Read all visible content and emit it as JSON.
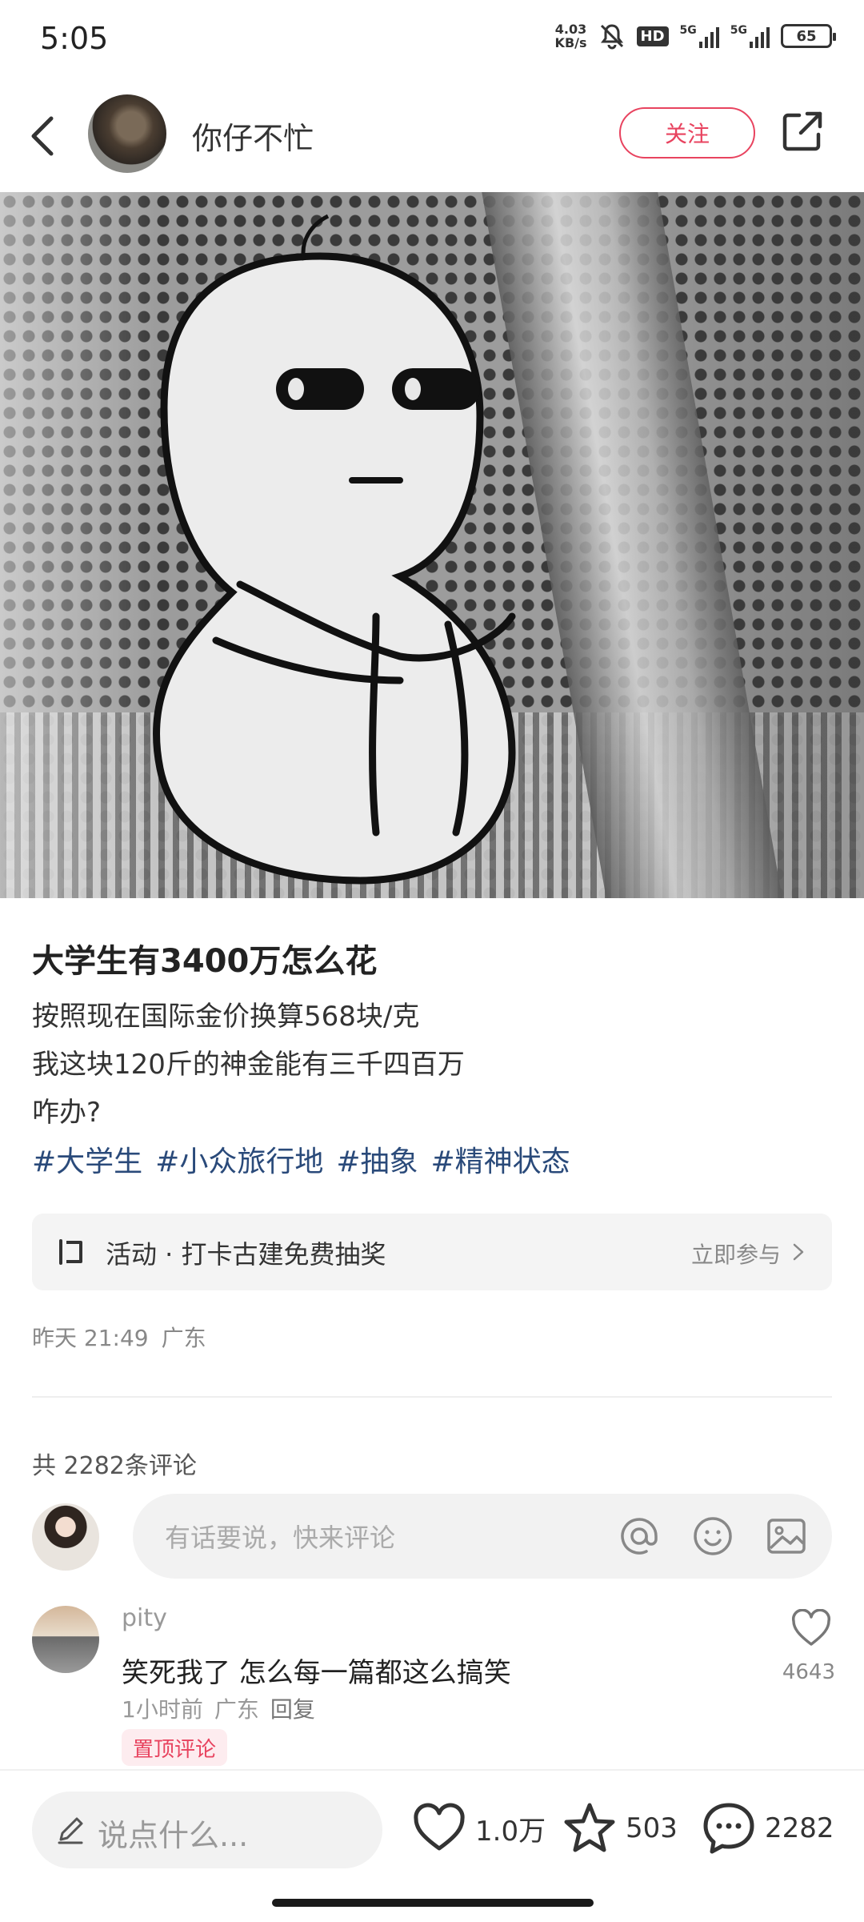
{
  "status_bar": {
    "time": "5:05",
    "net_speed_value": "4.03",
    "net_speed_unit": "KB/s",
    "hd_label": "HD",
    "signal1_label": "5G",
    "signal2_label": "5G",
    "battery": "65"
  },
  "header": {
    "author": "你仔不忙",
    "follow_label": "关注"
  },
  "post": {
    "title": "大学生有3400万怎么花",
    "body": [
      "按照现在国际金价换算568块/克",
      "我这块120斤的神金能有三千四百万",
      "咋办?"
    ],
    "tags": [
      "#大学生",
      "#小众旅行地",
      "#抽象",
      "#精神状态"
    ],
    "activity_label": "活动 · 打卡古建免费抽奖",
    "activity_join": "立即参与",
    "date": "昨天 21:49",
    "location": "广东"
  },
  "comments": {
    "count_label": "共 2282条评论",
    "input_placeholder": "有话要说，快来评论",
    "items": [
      {
        "user": "pity",
        "text": "笑死我了 怎么每一篇都这么搞笑",
        "time": "1小时前",
        "location": "广东",
        "reply_label": "回复",
        "pinned_label": "置顶评论",
        "likes": "4643"
      }
    ]
  },
  "bottom_bar": {
    "input_placeholder": "说点什么...",
    "likes": "1.0万",
    "favorites": "503",
    "comments": "2282"
  },
  "colors": {
    "accent": "#e8435f",
    "tag": "#2a4a7a"
  }
}
